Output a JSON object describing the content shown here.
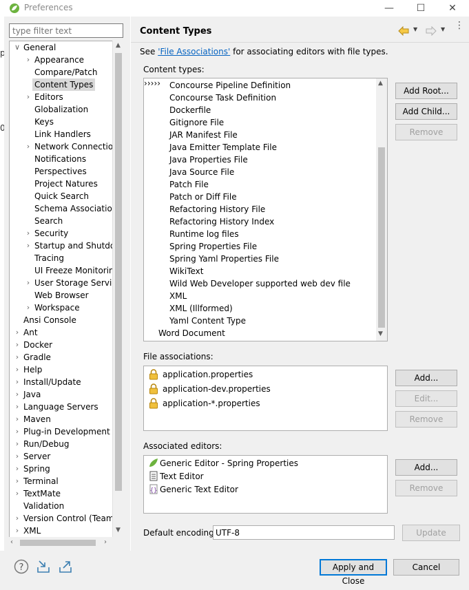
{
  "window": {
    "title": "Preferences",
    "minimize": "—",
    "maximize": "☐",
    "close": "✕"
  },
  "edge_strip": [
    "p",
    "0"
  ],
  "filter": {
    "placeholder": "type filter text"
  },
  "tree": [
    {
      "label": "General",
      "level": 0,
      "twisty": "open"
    },
    {
      "label": "Appearance",
      "level": 1,
      "twisty": "closed"
    },
    {
      "label": "Compare/Patch",
      "level": 1,
      "twisty": ""
    },
    {
      "label": "Content Types",
      "level": 1,
      "twisty": "",
      "selected": true
    },
    {
      "label": "Editors",
      "level": 1,
      "twisty": "closed"
    },
    {
      "label": "Globalization",
      "level": 1,
      "twisty": ""
    },
    {
      "label": "Keys",
      "level": 1,
      "twisty": ""
    },
    {
      "label": "Link Handlers",
      "level": 1,
      "twisty": ""
    },
    {
      "label": "Network Connections",
      "level": 1,
      "twisty": "closed"
    },
    {
      "label": "Notifications",
      "level": 1,
      "twisty": ""
    },
    {
      "label": "Perspectives",
      "level": 1,
      "twisty": ""
    },
    {
      "label": "Project Natures",
      "level": 1,
      "twisty": ""
    },
    {
      "label": "Quick Search",
      "level": 1,
      "twisty": ""
    },
    {
      "label": "Schema Associations",
      "level": 1,
      "twisty": ""
    },
    {
      "label": "Search",
      "level": 1,
      "twisty": ""
    },
    {
      "label": "Security",
      "level": 1,
      "twisty": "closed"
    },
    {
      "label": "Startup and Shutdown",
      "level": 1,
      "twisty": "closed"
    },
    {
      "label": "Tracing",
      "level": 1,
      "twisty": ""
    },
    {
      "label": "UI Freeze Monitoring",
      "level": 1,
      "twisty": ""
    },
    {
      "label": "User Storage Service",
      "level": 1,
      "twisty": "closed"
    },
    {
      "label": "Web Browser",
      "level": 1,
      "twisty": ""
    },
    {
      "label": "Workspace",
      "level": 1,
      "twisty": "closed"
    },
    {
      "label": "Ansi Console",
      "level": 0,
      "twisty": ""
    },
    {
      "label": "Ant",
      "level": 0,
      "twisty": "closed"
    },
    {
      "label": "Docker",
      "level": 0,
      "twisty": "closed"
    },
    {
      "label": "Gradle",
      "level": 0,
      "twisty": "closed"
    },
    {
      "label": "Help",
      "level": 0,
      "twisty": "closed"
    },
    {
      "label": "Install/Update",
      "level": 0,
      "twisty": "closed"
    },
    {
      "label": "Java",
      "level": 0,
      "twisty": "closed"
    },
    {
      "label": "Language Servers",
      "level": 0,
      "twisty": "closed"
    },
    {
      "label": "Maven",
      "level": 0,
      "twisty": "closed"
    },
    {
      "label": "Plug-in Development",
      "level": 0,
      "twisty": "closed"
    },
    {
      "label": "Run/Debug",
      "level": 0,
      "twisty": "closed"
    },
    {
      "label": "Server",
      "level": 0,
      "twisty": "closed"
    },
    {
      "label": "Spring",
      "level": 0,
      "twisty": "closed"
    },
    {
      "label": "Terminal",
      "level": 0,
      "twisty": "closed"
    },
    {
      "label": "TextMate",
      "level": 0,
      "twisty": "closed"
    },
    {
      "label": "Validation",
      "level": 0,
      "twisty": ""
    },
    {
      "label": "Version Control (Team)",
      "level": 0,
      "twisty": "closed"
    },
    {
      "label": "XML",
      "level": 0,
      "twisty": "closed"
    }
  ],
  "page": {
    "title": "Content Types",
    "desc_prefix": "See ",
    "desc_link": "'File Associations'",
    "desc_suffix": " for associating editors with file types.",
    "content_types_label": "Content types:",
    "file_assoc_label": "File associations:",
    "assoc_editors_label": "Associated editors:",
    "encoding_label": "Default encoding:",
    "encoding_value": "UTF-8"
  },
  "content_types": [
    {
      "label": "Concourse Pipeline Definition",
      "level": 1,
      "twisty": ""
    },
    {
      "label": "Concourse Task Definition",
      "level": 1,
      "twisty": ""
    },
    {
      "label": "Dockerfile",
      "level": 1,
      "twisty": ""
    },
    {
      "label": "Gitignore File",
      "level": 1,
      "twisty": ""
    },
    {
      "label": "JAR Manifest File",
      "level": 1,
      "twisty": "closed"
    },
    {
      "label": "Java Emitter Template File",
      "level": 1,
      "twisty": ""
    },
    {
      "label": "Java Properties File",
      "level": 1,
      "twisty": "closed"
    },
    {
      "label": "Java Source File",
      "level": 1,
      "twisty": ""
    },
    {
      "label": "Patch File",
      "level": 1,
      "twisty": ""
    },
    {
      "label": "Patch or Diff File",
      "level": 1,
      "twisty": ""
    },
    {
      "label": "Refactoring History File",
      "level": 1,
      "twisty": ""
    },
    {
      "label": "Refactoring History Index",
      "level": 1,
      "twisty": ""
    },
    {
      "label": "Runtime log files",
      "level": 1,
      "twisty": ""
    },
    {
      "label": "Spring Properties File",
      "level": 1,
      "twisty": "",
      "selected": true
    },
    {
      "label": "Spring Yaml Properties File",
      "level": 1,
      "twisty": ""
    },
    {
      "label": "WikiText",
      "level": 1,
      "twisty": "closed"
    },
    {
      "label": "Wild Web Developer supported web dev file",
      "level": 1,
      "twisty": "closed"
    },
    {
      "label": "XML",
      "level": 1,
      "twisty": "closed"
    },
    {
      "label": "XML (Illformed)",
      "level": 1,
      "twisty": ""
    },
    {
      "label": "Yaml Content Type",
      "level": 1,
      "twisty": ""
    },
    {
      "label": "Word Document",
      "level": 0,
      "twisty": ""
    }
  ],
  "file_associations": [
    "application.properties",
    "application-dev.properties",
    "application-*.properties"
  ],
  "associated_editors": [
    {
      "label": "Generic Editor - Spring Properties",
      "icon": "spring-leaf-icon"
    },
    {
      "label": "Text Editor",
      "icon": "text-file-icon"
    },
    {
      "label": "Generic Text Editor",
      "icon": "generic-editor-icon"
    }
  ],
  "buttons": {
    "add_root": "Add Root...",
    "add_child": "Add Child...",
    "remove": "Remove",
    "fa_add": "Add...",
    "fa_edit": "Edit...",
    "fa_remove": "Remove",
    "ae_add": "Add...",
    "ae_remove": "Remove",
    "update": "Update",
    "apply_close": "Apply and Close",
    "cancel": "Cancel"
  },
  "colors": {
    "accent_link": "#0563c1",
    "selection": "#d9d9d9",
    "default_button_border": "#0078d7"
  }
}
